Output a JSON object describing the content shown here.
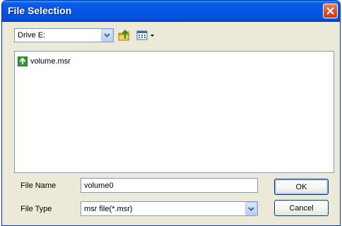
{
  "window": {
    "title": "File Selection"
  },
  "toolbar": {
    "drive": "Drive E:",
    "icons": [
      "up-folder-icon",
      "view-menu-icon"
    ]
  },
  "file_list": {
    "items": [
      {
        "name": "volume.msr",
        "icon": "up-arrow-file-icon"
      }
    ]
  },
  "form": {
    "file_name_label": "File Name",
    "file_name_value": "volume0",
    "file_type_label": "File Type",
    "file_type_value": "msr file(*.msr)"
  },
  "buttons": {
    "ok": "OK",
    "cancel": "Cancel"
  },
  "colors": {
    "title_bar": "#0554e3",
    "close": "#d65a3a",
    "dialog_bg": "#ece9d8",
    "field_border": "#7f9db9"
  }
}
